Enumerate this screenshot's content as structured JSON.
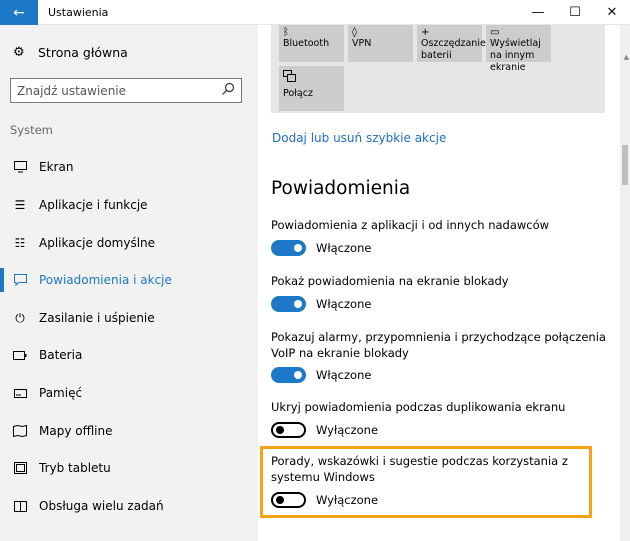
{
  "window": {
    "title": "Ustawienia",
    "back_icon": "arrow-left-icon",
    "minimize": "—",
    "maximize": "☐",
    "close": "✕",
    "accent": "#1e78c8"
  },
  "sidebar": {
    "home_label": "Strona główna",
    "search_placeholder": "Znajdź ustawienie",
    "section_label": "System",
    "items": [
      {
        "label": "Ekran",
        "icon": "monitor-icon"
      },
      {
        "label": "Aplikacje i funkcje",
        "icon": "list-icon"
      },
      {
        "label": "Aplikacje domyślne",
        "icon": "list-check-icon"
      },
      {
        "label": "Powiadomienia i akcje",
        "icon": "notification-icon",
        "selected": true
      },
      {
        "label": "Zasilanie i uśpienie",
        "icon": "power-icon"
      },
      {
        "label": "Bateria",
        "icon": "battery-icon"
      },
      {
        "label": "Pamięć",
        "icon": "storage-icon"
      },
      {
        "label": "Mapy offline",
        "icon": "map-icon"
      },
      {
        "label": "Tryb tabletu",
        "icon": "tablet-icon"
      },
      {
        "label": "Obsługa wielu zadań",
        "icon": "multitask-icon"
      }
    ]
  },
  "quick_actions": {
    "tiles": [
      {
        "label": "Bluetooth",
        "icon": "bluetooth-icon"
      },
      {
        "label": "VPN",
        "icon": "vpn-icon"
      },
      {
        "label": "Oszczędzanie baterii",
        "icon": "battery-saver-icon"
      },
      {
        "label": "Wyświetlaj na innym ekranie",
        "icon": "project-icon"
      },
      {
        "label": "Połącz",
        "icon": "connect-icon"
      }
    ],
    "link": "Dodaj lub usuń szybkie akcje"
  },
  "notifications": {
    "title": "Powiadomienia",
    "settings": [
      {
        "label": "Powiadomienia z aplikacji i od innych nadawców",
        "state": "Włączone",
        "on": true
      },
      {
        "label": "Pokaż powiadomienia na ekranie blokady",
        "state": "Włączone",
        "on": true
      },
      {
        "label": "Pokazuj alarmy, przypomnienia i przychodzące połączenia VoIP na ekranie blokady",
        "state": "Włączone",
        "on": true
      },
      {
        "label": "Ukryj powiadomienia podczas duplikowania ekranu",
        "state": "Wyłączone",
        "on": false
      },
      {
        "label": "Porady, wskazówki i sugestie podczas korzystania z systemu Windows",
        "state": "Wyłączone",
        "on": false
      }
    ],
    "highlight_color": "#f5a217"
  }
}
